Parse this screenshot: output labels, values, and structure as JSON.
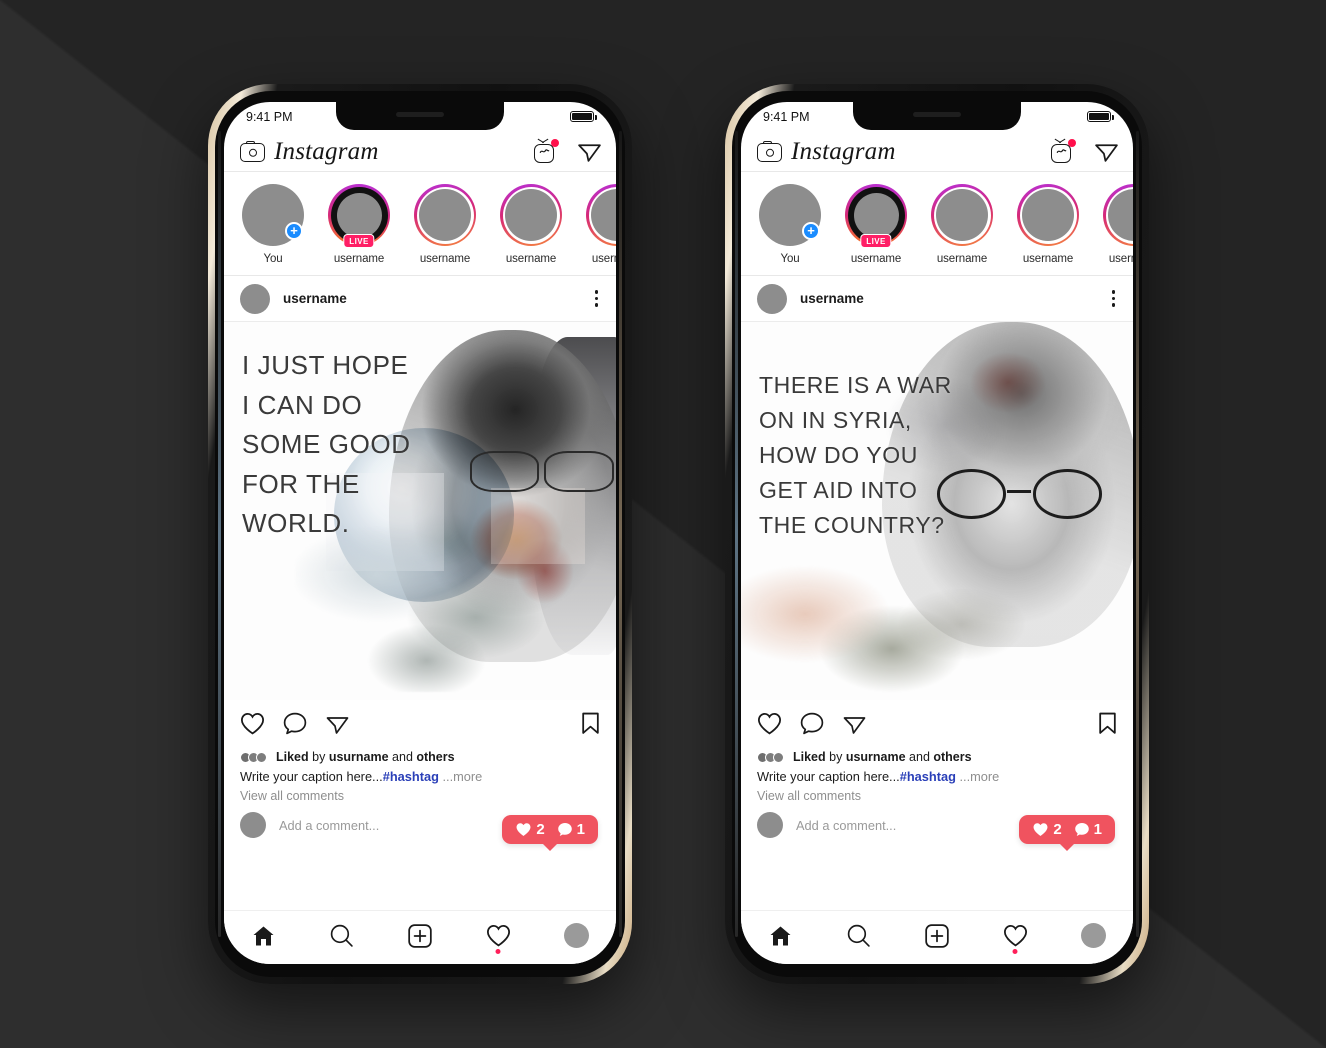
{
  "background": {
    "color_top": "#242424",
    "color_bottom": "#2e2e2e"
  },
  "phones": [
    {
      "id": "phone-left",
      "status": {
        "time": "9:41 PM",
        "battery_icon": "battery-full-icon"
      },
      "app_header": {
        "camera_icon": "camera-icon",
        "brand": "Instagram",
        "igtv_icon": "igtv-icon",
        "igtv_has_badge": true,
        "dm_icon": "paper-plane-icon"
      },
      "stories": [
        {
          "label": "You",
          "type": "own",
          "has_plus": true,
          "plus_label": "+"
        },
        {
          "label": "username",
          "type": "live",
          "live_label": "LIVE"
        },
        {
          "label": "username",
          "type": "ring"
        },
        {
          "label": "username",
          "type": "ring"
        },
        {
          "label": "username",
          "type": "ring"
        }
      ],
      "post": {
        "username": "username",
        "more_icon": "kebab-menu-icon",
        "quote_lines": [
          "I JUST HOPE",
          "I CAN DO",
          "SOME GOOD",
          "FOR THE",
          "WORLD."
        ],
        "actions": {
          "like_icon": "heart-icon",
          "comment_icon": "speech-bubble-icon",
          "share_icon": "paper-plane-icon",
          "save_icon": "bookmark-icon"
        },
        "liked_by_prefix": "Liked",
        "liked_by_mid": " by ",
        "liked_by_user": "usurname",
        "liked_by_suffix": " and ",
        "liked_by_others": "others",
        "caption_text": "Write your caption here...",
        "caption_hashtag": "#hashtag",
        "caption_more": " ...more",
        "view_all_comments": "View all comments",
        "add_comment_placeholder": "Add a comment...",
        "badge": {
          "like_icon": "heart-filled-icon",
          "like_count": "2",
          "comment_icon": "comment-filled-icon",
          "comment_count": "1",
          "color": "#f0535f"
        }
      },
      "tabbar": {
        "home_icon": "home-filled-icon",
        "search_icon": "magnifier-icon",
        "add_icon": "plus-square-icon",
        "activity_icon": "heart-icon",
        "activity_has_dot": true,
        "profile_icon": "profile-avatar-icon"
      }
    },
    {
      "id": "phone-right",
      "status": {
        "time": "9:41 PM",
        "battery_icon": "battery-full-icon"
      },
      "app_header": {
        "camera_icon": "camera-icon",
        "brand": "Instagram",
        "igtv_icon": "igtv-icon",
        "igtv_has_badge": true,
        "dm_icon": "paper-plane-icon"
      },
      "stories": [
        {
          "label": "You",
          "type": "own",
          "has_plus": true,
          "plus_label": "+"
        },
        {
          "label": "username",
          "type": "live",
          "live_label": "LIVE"
        },
        {
          "label": "username",
          "type": "ring"
        },
        {
          "label": "username",
          "type": "ring"
        },
        {
          "label": "username",
          "type": "ring"
        }
      ],
      "post": {
        "username": "username",
        "more_icon": "kebab-menu-icon",
        "quote_lines": [
          "THERE IS A WAR",
          "ON IN SYRIA,",
          "HOW DO YOU",
          "GET AID INTO",
          "THE COUNTRY?"
        ],
        "actions": {
          "like_icon": "heart-icon",
          "comment_icon": "speech-bubble-icon",
          "share_icon": "paper-plane-icon",
          "save_icon": "bookmark-icon"
        },
        "liked_by_prefix": "Liked",
        "liked_by_mid": " by ",
        "liked_by_user": "usurname",
        "liked_by_suffix": " and ",
        "liked_by_others": "others",
        "caption_text": "Write your caption here...",
        "caption_hashtag": "#hashtag",
        "caption_more": " ...more",
        "view_all_comments": "View all comments",
        "add_comment_placeholder": "Add a comment...",
        "badge": {
          "like_icon": "heart-filled-icon",
          "like_count": "2",
          "comment_icon": "comment-filled-icon",
          "comment_count": "1",
          "color": "#f0535f"
        }
      },
      "tabbar": {
        "home_icon": "home-filled-icon",
        "search_icon": "magnifier-icon",
        "add_icon": "plus-square-icon",
        "activity_icon": "heart-icon",
        "activity_has_dot": true,
        "profile_icon": "profile-avatar-icon"
      }
    }
  ]
}
